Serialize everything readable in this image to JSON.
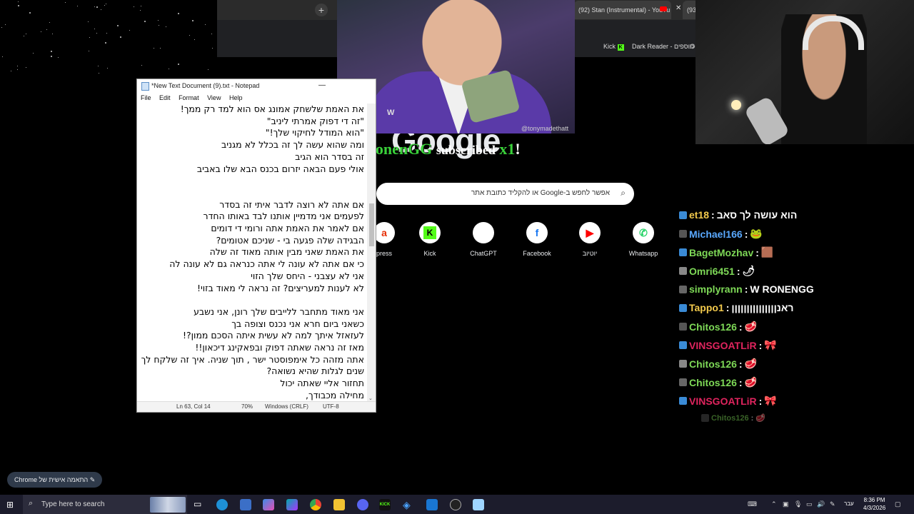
{
  "chrome": {
    "tabs": [
      {
        "label": "(92) Stan (Instrumental) - YouTu"
      },
      {
        "label": "(93"
      }
    ],
    "tab_close_glyph": "✕",
    "new_tab_glyph": "+",
    "bookmarks": [
      "Kick",
      "Dark Reader - תוספים"
    ]
  },
  "meme": {
    "watermark": "@tonymadethatt"
  },
  "google": {
    "logo": "Google",
    "search_placeholder": "אפשר לחפש ב-Google או להקליד כתובת אתר",
    "shortcuts": [
      {
        "label": "press",
        "icon": "aliexpress-icon",
        "glyph": "a",
        "color": "#e62e04"
      },
      {
        "label": "Kick",
        "icon": "kick-icon",
        "glyph": "K",
        "color": "#53fc18"
      },
      {
        "label": "ChatGPT",
        "icon": "chatgpt-icon",
        "glyph": "",
        "color": "#ffffff"
      },
      {
        "label": "Facebook",
        "icon": "facebook-icon",
        "glyph": "f",
        "color": "#1877f2"
      },
      {
        "label": "יוטיוב",
        "icon": "youtube-icon",
        "glyph": "▶",
        "color": "#ff0000"
      },
      {
        "label": "Whatsapp",
        "icon": "whatsapp-icon",
        "glyph": "✆",
        "color": "#25d366"
      }
    ]
  },
  "sub_alert": {
    "name": "RonenGG",
    "text": "subscribed",
    "count": "x1",
    "bang": "!"
  },
  "chat": [
    {
      "user": "et18",
      "color": "#f2c94c",
      "msg": "הוא עושה לך סאב"
    },
    {
      "user": "Michael166",
      "color": "#5aa9ff",
      "msg": "🐸"
    },
    {
      "user": "BagetMozhav",
      "color": "#7ed957",
      "msg": "🟫"
    },
    {
      "user": "Omri6451",
      "color": "#7ed957",
      "msg": "🌶"
    },
    {
      "user": "simplyrann",
      "color": "#7ed957",
      "msg": "W RONENGG"
    },
    {
      "user": "Tappo1",
      "color": "#f2c94c",
      "msg": "ראנןןןןןןןןןןןןןןן"
    },
    {
      "user": "Chitos126",
      "color": "#7ed957",
      "msg": "🥩"
    },
    {
      "user": "VINSGOATLiR",
      "color": "#e0245e",
      "msg": "🎀"
    },
    {
      "user": "Chitos126",
      "color": "#7ed957",
      "msg": "🥩"
    },
    {
      "user": "Chitos126",
      "color": "#7ed957",
      "msg": "🥩"
    },
    {
      "user": "VINSGOATLiR",
      "color": "#e0245e",
      "msg": "🎀"
    },
    {
      "user": "Chitos126",
      "color": "#7ed957",
      "msg": "🥩"
    }
  ],
  "notepad": {
    "title": "*New Text Document (9).txt - Notepad",
    "menu": [
      "File",
      "Edit",
      "Format",
      "View",
      "Help"
    ],
    "lines": [
      "את האמת שלשחק אמונג אס הוא למד רק ממך!",
      "\"זה די דפוק אמרתי ליניב\"",
      "\"הוא המודל לחיקוי שלך!\"",
      "ומה שהוא עשה לך זה בכלל לא מגניב",
      "זה בסדר הוא הגיב",
      "אולי פעם הבאה יזרום בכנס הבא שלו באביב",
      "",
      "",
      "אם אתה לא רוצה לדבר איתי זה בסדר",
      "לפעמים אני מדמיין אותנו לבד באותו החדר",
      "אם לאמר את האמת אתה ורומי די דומים",
      "הבגידה שלה פגעה בי - שניכם אטומים?",
      "את האמת שאני מבין אותה מאוד זה שלה",
      "כי אם אתה לא עונה לי אתה כנראה גם לא עונה לה",
      "אני לא עצבני - היחס שלך הזוי",
      "לא לענות למעריצים? זה נראה לי מאוד בזוי!",
      "",
      "אני מאוד מתחבר ללייבים שלך רונן, אני נשבע",
      "כשאני ביום חרא אני נכנס וצופה בך",
      "לעזאזל איתך למה לא עשית איתה הסכם ממון?!",
      "מאז זה נראה שאתה דפוק ובפאקינג דיכאון!!",
      "אתה מזהה כל אימפוסטר ישר , תוך שניה. איך זה שלקח לך",
      "שנים לגלות שהיא נשואה?",
      "תחזור אליי שאתה יכול",
      "מחילה מכבודך,"
    ],
    "status": {
      "pos": "Ln 63, Col 14",
      "zoom": "70%",
      "eol": "Windows (CRLF)",
      "enc": "UTF-8"
    }
  },
  "profile_chip": {
    "text": "Chrome התאמה אישית של"
  },
  "taskbar": {
    "search_placeholder": "Type here to search",
    "time": "8:36 PM",
    "date": "4/3/2026",
    "lang": "עבר"
  }
}
